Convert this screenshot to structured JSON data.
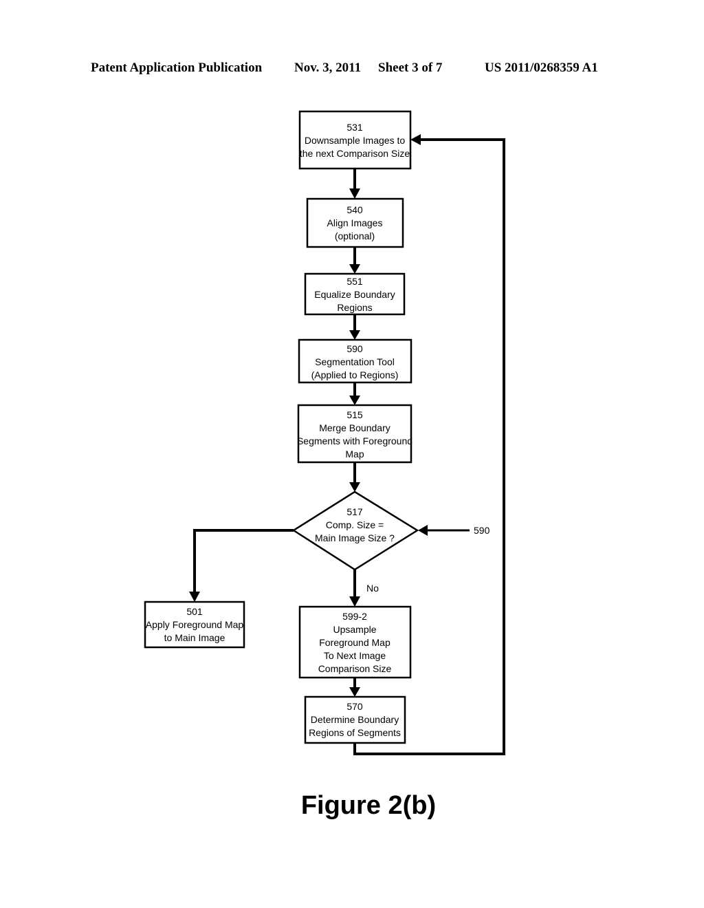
{
  "header": {
    "publication": "Patent Application Publication",
    "date": "Nov. 3, 2011",
    "sheet": "Sheet 3 of 7",
    "number": "US 2011/0268359 A1"
  },
  "nodes": [
    {
      "id": "531",
      "type": "process",
      "lines": [
        "531",
        "Downsample Images to",
        "the next Comparison Size"
      ]
    },
    {
      "id": "540",
      "type": "process",
      "lines": [
        "540",
        "Align Images",
        "(optional)"
      ]
    },
    {
      "id": "551",
      "type": "process",
      "lines": [
        "551",
        "Equalize Boundary",
        "Regions"
      ]
    },
    {
      "id": "590",
      "type": "process",
      "lines": [
        "590",
        "Segmentation Tool",
        "(Applied to Regions)"
      ]
    },
    {
      "id": "515",
      "type": "process",
      "lines": [
        "515",
        "Merge Boundary",
        "Segments with Foreground",
        "Map"
      ]
    },
    {
      "id": "517",
      "type": "decision",
      "lines": [
        "517",
        "Comp. Size =",
        "Main Image Size ?"
      ]
    },
    {
      "id": "501",
      "type": "process",
      "lines": [
        "501",
        "Apply Foreground Map",
        "to Main Image"
      ]
    },
    {
      "id": "599-2",
      "type": "process",
      "lines": [
        "599-2",
        "Upsample",
        "Foreground Map",
        "To Next Image",
        "Comparison Size"
      ]
    },
    {
      "id": "570",
      "type": "process",
      "lines": [
        "570",
        "Determine Boundary",
        "Regions of Segments"
      ]
    }
  ],
  "edges": [
    {
      "from": "531",
      "to": "540",
      "label": ""
    },
    {
      "from": "540",
      "to": "551",
      "label": ""
    },
    {
      "from": "551",
      "to": "590",
      "label": ""
    },
    {
      "from": "590",
      "to": "515",
      "label": ""
    },
    {
      "from": "515",
      "to": "517",
      "label": ""
    },
    {
      "from": "517",
      "to": "501",
      "label": ""
    },
    {
      "from": "517",
      "to": "599-2",
      "label": "No"
    },
    {
      "from": "599-2",
      "to": "570",
      "label": ""
    },
    {
      "from": "570",
      "to": "531",
      "label": ""
    },
    {
      "from": "590-ref",
      "to": "517",
      "label": "590"
    }
  ],
  "edge_labels": {
    "no": "No",
    "external_ref": "590"
  },
  "caption": "Figure 2(b)"
}
